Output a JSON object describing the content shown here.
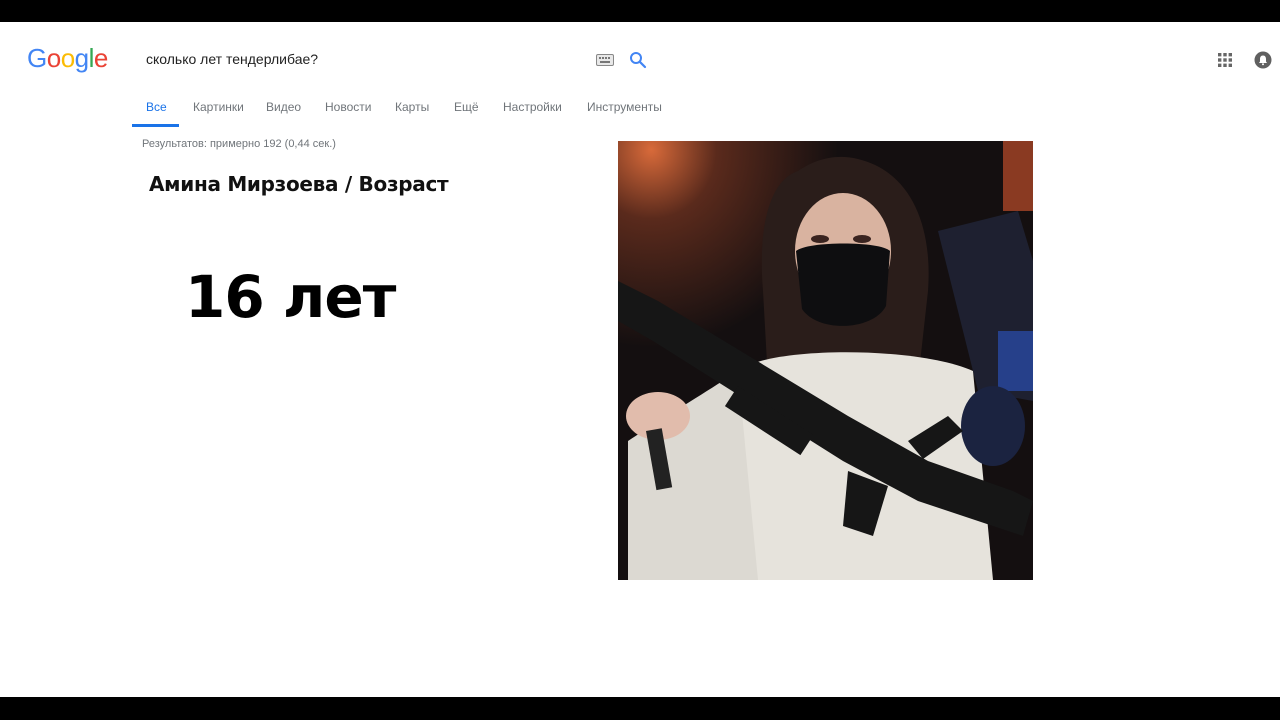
{
  "logo": {
    "letters": [
      "G",
      "o",
      "o",
      "g",
      "l",
      "e"
    ],
    "colors": [
      "#4285F4",
      "#EA4335",
      "#FBBC05",
      "#4285F4",
      "#34A853",
      "#EA4335"
    ]
  },
  "search": {
    "query": "сколько лет тендерлибае?"
  },
  "tabs": [
    {
      "label": "Все",
      "active": true
    },
    {
      "label": "Картинки"
    },
    {
      "label": "Видео"
    },
    {
      "label": "Новости"
    },
    {
      "label": "Карты"
    },
    {
      "label": "Ещё"
    },
    {
      "label": "Настройки"
    },
    {
      "label": "Инструменты"
    }
  ],
  "result_stats": "Результатов: примерно 192 (0,44 сек.)",
  "answer": {
    "title": "Амина Мирзоева / Возраст",
    "value": "16 лет"
  },
  "colors": {
    "accent": "#1a73e8",
    "tab_inactive": "#70757a"
  }
}
